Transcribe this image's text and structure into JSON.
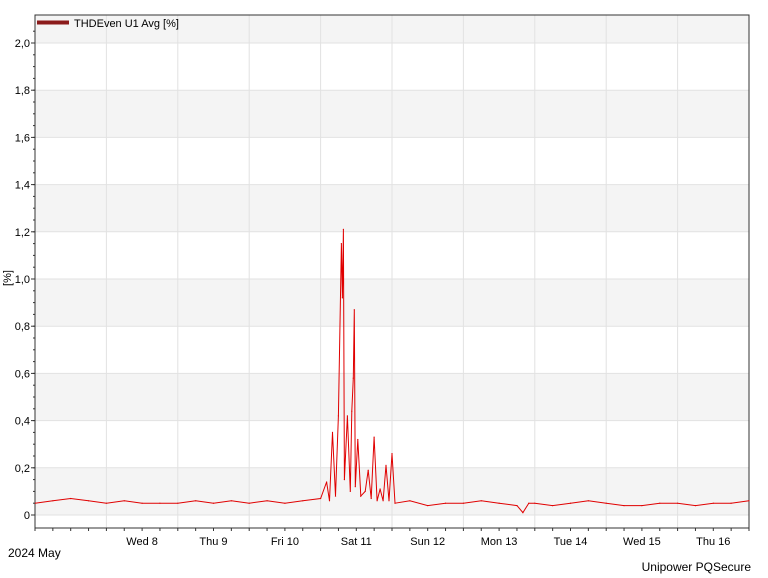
{
  "chart_data": {
    "type": "line",
    "ylabel": "[%]",
    "xlabel": "",
    "ylim": [
      0,
      2.1
    ],
    "yticks": [
      "0",
      "0,2",
      "0,4",
      "0,6",
      "0,8",
      "1,0",
      "1,2",
      "1,4",
      "1,6",
      "1,8",
      "2,0"
    ],
    "xlim": [
      "2024-05-07 00:00",
      "2024-05-16 24:00"
    ],
    "xticks": [
      {
        "date": "2024-05-08 12:00",
        "label": "Wed 8"
      },
      {
        "date": "2024-05-09 12:00",
        "label": "Thu 9"
      },
      {
        "date": "2024-05-10 12:00",
        "label": "Fri 10"
      },
      {
        "date": "2024-05-11 12:00",
        "label": "Sat 11"
      },
      {
        "date": "2024-05-12 12:00",
        "label": "Sun 12"
      },
      {
        "date": "2024-05-13 12:00",
        "label": "Mon 13"
      },
      {
        "date": "2024-05-14 12:00",
        "label": "Tue 14"
      },
      {
        "date": "2024-05-15 12:00",
        "label": "Wed 15"
      },
      {
        "date": "2024-05-16 12:00",
        "label": "Thu 16"
      }
    ],
    "grid": true,
    "legend_position": "top-left",
    "series": [
      {
        "name": "THDEven U1 Avg [%]",
        "color": "#e00000",
        "legend_color": "#8b1a1a",
        "points": [
          [
            "2024-05-07 00:00",
            0.05
          ],
          [
            "2024-05-07 06:00",
            0.06
          ],
          [
            "2024-05-07 12:00",
            0.07
          ],
          [
            "2024-05-07 18:00",
            0.06
          ],
          [
            "2024-05-08 00:00",
            0.05
          ],
          [
            "2024-05-08 06:00",
            0.06
          ],
          [
            "2024-05-08 12:00",
            0.05
          ],
          [
            "2024-05-08 18:00",
            0.05
          ],
          [
            "2024-05-09 00:00",
            0.05
          ],
          [
            "2024-05-09 06:00",
            0.06
          ],
          [
            "2024-05-09 12:00",
            0.05
          ],
          [
            "2024-05-09 18:00",
            0.06
          ],
          [
            "2024-05-10 00:00",
            0.05
          ],
          [
            "2024-05-10 06:00",
            0.06
          ],
          [
            "2024-05-10 12:00",
            0.05
          ],
          [
            "2024-05-10 18:00",
            0.06
          ],
          [
            "2024-05-11 00:00",
            0.07
          ],
          [
            "2024-05-11 02:00",
            0.14
          ],
          [
            "2024-05-11 03:00",
            0.06
          ],
          [
            "2024-05-11 04:00",
            0.35
          ],
          [
            "2024-05-11 05:00",
            0.08
          ],
          [
            "2024-05-11 06:00",
            0.42
          ],
          [
            "2024-05-11 07:00",
            1.15
          ],
          [
            "2024-05-11 07:20",
            0.92
          ],
          [
            "2024-05-11 07:40",
            1.21
          ],
          [
            "2024-05-11 08:00",
            0.15
          ],
          [
            "2024-05-11 09:00",
            0.42
          ],
          [
            "2024-05-11 10:00",
            0.1
          ],
          [
            "2024-05-11 10:30",
            0.44
          ],
          [
            "2024-05-11 11:00",
            0.58
          ],
          [
            "2024-05-11 11:20",
            0.87
          ],
          [
            "2024-05-11 11:40",
            0.12
          ],
          [
            "2024-05-11 12:30",
            0.32
          ],
          [
            "2024-05-11 13:30",
            0.08
          ],
          [
            "2024-05-11 15:00",
            0.1
          ],
          [
            "2024-05-11 16:00",
            0.19
          ],
          [
            "2024-05-11 17:00",
            0.07
          ],
          [
            "2024-05-11 18:00",
            0.33
          ],
          [
            "2024-05-11 19:00",
            0.06
          ],
          [
            "2024-05-11 20:00",
            0.11
          ],
          [
            "2024-05-11 21:00",
            0.06
          ],
          [
            "2024-05-11 22:00",
            0.21
          ],
          [
            "2024-05-11 23:00",
            0.06
          ],
          [
            "2024-05-12 00:00",
            0.26
          ],
          [
            "2024-05-12 01:00",
            0.05
          ],
          [
            "2024-05-12 06:00",
            0.06
          ],
          [
            "2024-05-12 12:00",
            0.04
          ],
          [
            "2024-05-12 18:00",
            0.05
          ],
          [
            "2024-05-13 00:00",
            0.05
          ],
          [
            "2024-05-13 06:00",
            0.06
          ],
          [
            "2024-05-13 12:00",
            0.05
          ],
          [
            "2024-05-13 18:00",
            0.04
          ],
          [
            "2024-05-13 20:00",
            0.01
          ],
          [
            "2024-05-13 22:00",
            0.05
          ],
          [
            "2024-05-14 00:00",
            0.05
          ],
          [
            "2024-05-14 06:00",
            0.04
          ],
          [
            "2024-05-14 12:00",
            0.05
          ],
          [
            "2024-05-14 18:00",
            0.06
          ],
          [
            "2024-05-15 00:00",
            0.05
          ],
          [
            "2024-05-15 06:00",
            0.04
          ],
          [
            "2024-05-15 12:00",
            0.04
          ],
          [
            "2024-05-15 18:00",
            0.05
          ],
          [
            "2024-05-16 00:00",
            0.05
          ],
          [
            "2024-05-16 06:00",
            0.04
          ],
          [
            "2024-05-16 12:00",
            0.05
          ],
          [
            "2024-05-16 18:00",
            0.05
          ],
          [
            "2024-05-16 24:00",
            0.06
          ]
        ]
      }
    ]
  },
  "footer": {
    "period": "2024 May",
    "brand": "Unipower PQSecure"
  }
}
